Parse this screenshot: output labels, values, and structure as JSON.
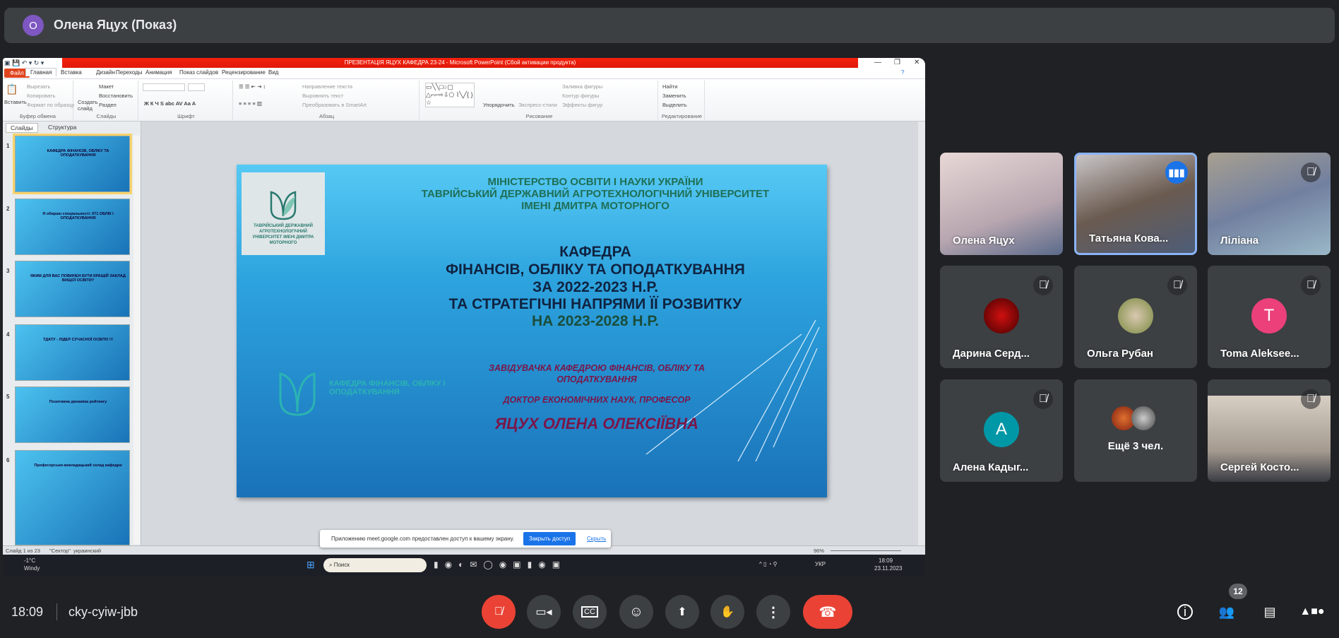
{
  "meet": {
    "presenter_initial": "О",
    "presenter_title": "Олена Яцух (Показ)",
    "time": "18:09",
    "meeting_code": "cky-cyiw-jbb",
    "participants_count": "12",
    "tiles": [
      {
        "name": "Олена Яцух",
        "type": "video",
        "muted": false
      },
      {
        "name": "Татьяна Кова...",
        "type": "video",
        "speaking": true
      },
      {
        "name": "Ліліана",
        "type": "video",
        "muted": true
      },
      {
        "name": "Дарина Серд...",
        "type": "avatar-photo",
        "muted": true
      },
      {
        "name": "Ольга Рубан",
        "type": "avatar-photo",
        "muted": true
      },
      {
        "name": "Toma Aleksee...",
        "type": "initial",
        "initial": "T",
        "color": "#ec407a",
        "muted": true
      },
      {
        "name": "Алена Кадыг...",
        "type": "initial",
        "initial": "A",
        "color": "#0097a7",
        "muted": true
      },
      {
        "name": "Ещё 3 чел.",
        "type": "more"
      },
      {
        "name": "Сергей Косто...",
        "type": "video",
        "muted": true
      }
    ]
  },
  "ppt": {
    "window_title": "ПРЕЗЕНТАЦІЯ ЯЦУХ КАФЕДРА 23-24  -  Microsoft PowerPoint (Сбой активации продукта)",
    "tabs": [
      "Файл",
      "Главная",
      "Вставка",
      "Дизайн",
      "Переходы",
      "Анимация",
      "Показ слайдов",
      "Рецензирование",
      "Вид"
    ],
    "ribbon": {
      "clipboard": {
        "paste": "Вставить",
        "cut": "Вырезать",
        "copy": "Копировать",
        "format": "Формат по образцу",
        "label": "Буфер обмена"
      },
      "slides": {
        "new": "Создать слайд",
        "layout": "Макет",
        "reset": "Восстановить",
        "section": "Раздел",
        "label": "Слайды"
      },
      "font": {
        "label": "Шрифт"
      },
      "paragraph": {
        "dir": "Направление текста",
        "align": "Выровнять текст",
        "smartart": "Преобразовать в SmartArt",
        "label": "Абзац"
      },
      "drawing": {
        "arrange": "Упорядочить",
        "styles": "Экспресс-стили",
        "fill": "Заливка фигуры",
        "outline": "Контур фигуры",
        "effects": "Эффекты фигур",
        "label": "Рисование"
      },
      "editing": {
        "find": "Найти",
        "replace": "Заменить",
        "select": "Выделить",
        "label": "Редактирование"
      }
    },
    "panel_tabs": [
      "Слайды",
      "Структура"
    ],
    "thumbs": [
      {
        "n": "1",
        "text": "КАФЕДРА ФІНАНСІВ, ОБЛІКУ ТА ОПОДАТКУВАННЯ"
      },
      {
        "n": "2",
        "text": "Я обираю спеціальності: 071 ОБЛІК І ОПОДАТКУВАННЯ"
      },
      {
        "n": "3",
        "text": "ЯКИМ ДЛЯ ВАС ПОВИНЕН БУТИ КРАЩІЙ ЗАКЛАД ВИЩОЇ ОСВІТИ?"
      },
      {
        "n": "4",
        "text": "ТДАТУ - ЛІДЕР СУЧАСНОЇ ОСВІТИ !!!"
      },
      {
        "n": "5",
        "text": "Позитивна динаміка рейтингу"
      },
      {
        "n": "6",
        "text": "Професорсько-викладацький склад кафедри"
      }
    ],
    "slide": {
      "ministry": [
        "МІНІСТЕРСТВО ОСВІТИ І НАУКИ УКРАЇНИ",
        "ТАВРІЙСЬКИЙ ДЕРЖАВНИЙ АГРОТЕХНОЛОГІЧНИЙ УНІВЕРСИТЕТ",
        "ІМЕНІ ДМИТРА МОТОРНОГО"
      ],
      "logo_text": "ТАВРІЙСЬКИЙ ДЕРЖАВНИЙ АГРОТЕХНОЛОГІЧНИЙ УНІВЕРСИТЕТ ІМЕНІ ДМИТРА МОТОРНОГО",
      "title": [
        "КАФЕДРА",
        "ФІНАНСІВ, ОБЛІКУ ТА ОПОДАТКУВАННЯ",
        "ЗА 2022-2023 Н.Р.",
        "ТА СТРАТЕГІЧНІ НАПРЯМИ ЇЇ РОЗВИТКУ",
        "НА 2023-2028 Н.Р."
      ],
      "dept_logo": "КАФЕДРА ФІНАНСІВ, ОБЛІКУ І ОПОДАТКУВАННЯ",
      "head_role": "ЗАВІДУВАЧКА КАФЕДРОЮ ФІНАНСІВ, ОБЛІКУ ТА ОПОДАТКУВАННЯ",
      "degree": "ДОКТОР ЕКОНОМІЧНИХ НАУК, ПРОФЕСОР",
      "name": "ЯЦУХ ОЛЕНА ОЛЕКСІЇВНА"
    },
    "status": {
      "slide": "Слайд 1 из 23",
      "theme": "\"Сектор\"",
      "lang": "украинский",
      "zoom": "96%"
    },
    "notification": {
      "text": "Приложению meet.google.com предоставлен доступ к вашему экрану.",
      "stop": "Закрыть доступ",
      "hide": "Скрыть"
    },
    "taskbar": {
      "temp": "-1°C",
      "weather": "Windy",
      "search": "Поиск",
      "lang": "УКР",
      "time": "18:09",
      "date": "23.11.2023"
    }
  }
}
